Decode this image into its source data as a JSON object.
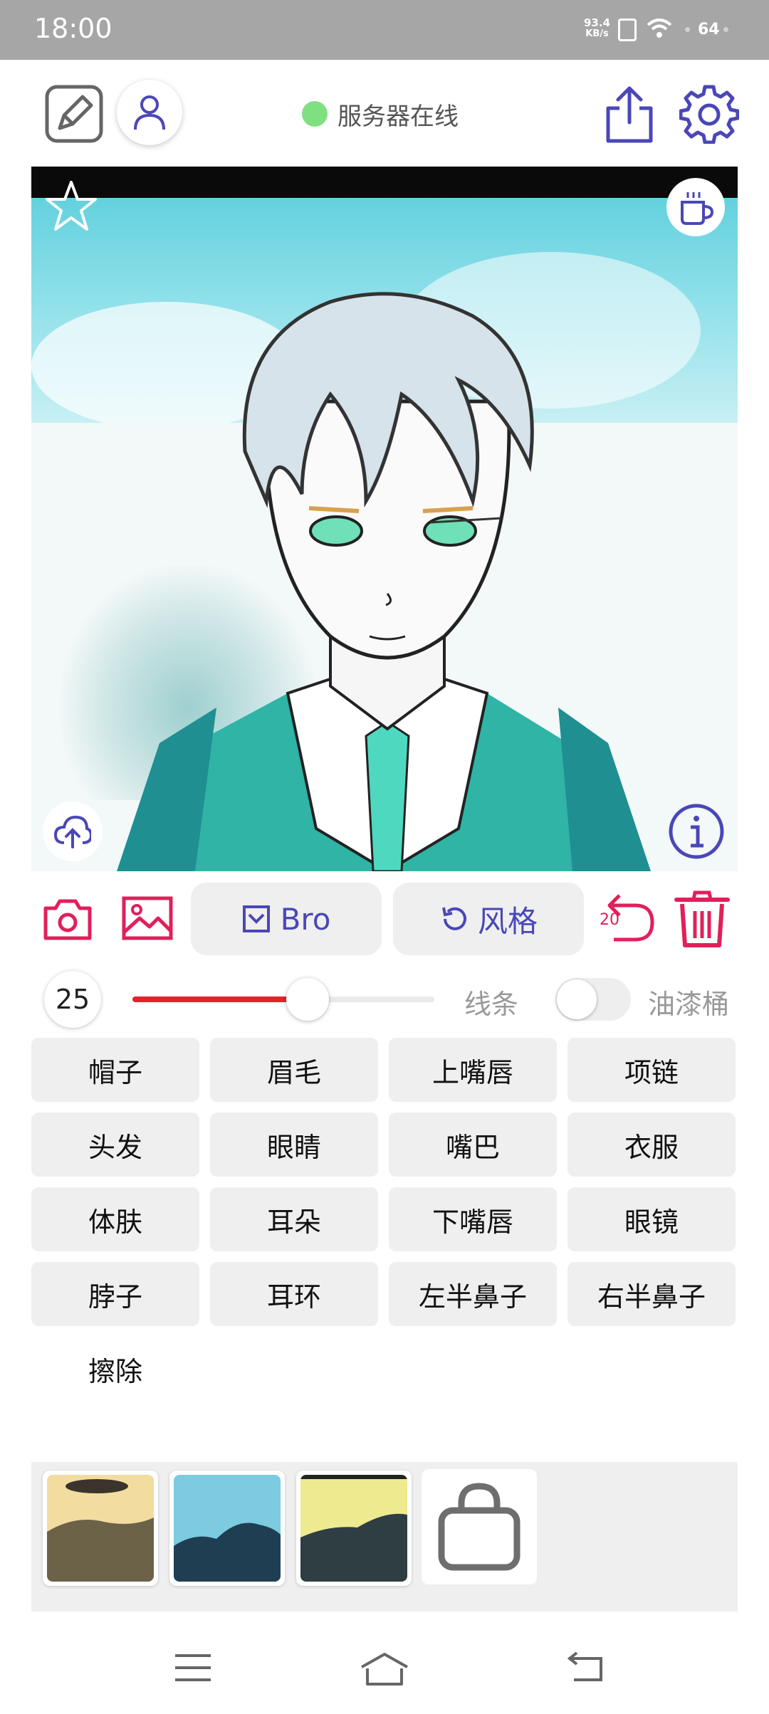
{
  "status_bar": {
    "time": "18:00",
    "net_rate_value": "93.4",
    "net_rate_unit": "KB/s",
    "battery": "64"
  },
  "header": {
    "server_status": "服务器在线",
    "server_status_color": "#7fe07f"
  },
  "toolbar": {
    "bro_label": "Bro",
    "style_label": "风格",
    "undo_count": "20",
    "accent_color": "#4a47b8",
    "danger_color": "#e0205a"
  },
  "brush": {
    "size": "25",
    "size_level": 0.58,
    "line_label": "线条",
    "bucket_label": "油漆桶",
    "bucket_enabled": false
  },
  "parts": [
    [
      "帽子",
      "眉毛",
      "上嘴唇",
      "项链"
    ],
    [
      "头发",
      "眼睛",
      "嘴巴",
      "衣服"
    ],
    [
      "体肤",
      "耳朵",
      "下嘴唇",
      "眼镜"
    ],
    [
      "脖子",
      "耳环",
      "左半鼻子",
      "右半鼻子"
    ]
  ],
  "erase_label": "擦除",
  "style_thumbs": [
    {
      "name": "style-1",
      "top": "#f3dca0",
      "bottom": "#6c6248"
    },
    {
      "name": "style-2",
      "top": "#7ccbe0",
      "bottom": "#1f3e52"
    },
    {
      "name": "style-3",
      "top": "#eeea90",
      "bottom": "#2e3e42"
    }
  ]
}
